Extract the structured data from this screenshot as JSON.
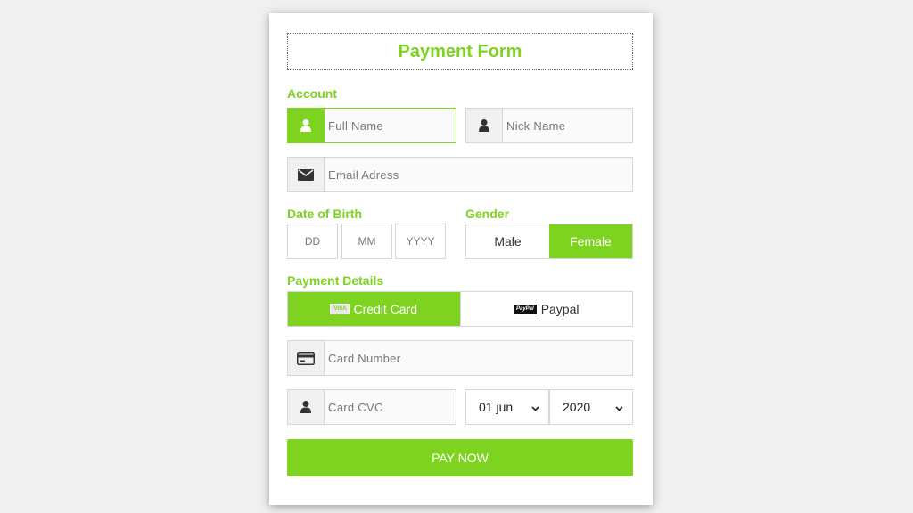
{
  "form": {
    "title": "Payment Form",
    "account_label": "Account",
    "full_name_placeholder": "Full Name",
    "nick_name_placeholder": "Nick Name",
    "email_placeholder": "Email Adress",
    "dob_label": "Date of Birth",
    "dob_day": "DD",
    "dob_month": "MM",
    "dob_year": "YYYY",
    "gender_label": "Gender",
    "gender_male": "Male",
    "gender_female": "Female",
    "gender_selected": "Female",
    "payment_label": "Payment Details",
    "method_credit": "Credit Card",
    "method_paypal": "Paypal",
    "method_selected": "Credit Card",
    "visa_badge": "VISA",
    "paypal_badge": "PayPal",
    "card_number_placeholder": "Card Number",
    "card_cvc_placeholder": "Card CVC",
    "expiry_month": "01 jun",
    "expiry_year": "2020",
    "pay_button": "PAY NOW"
  },
  "colors": {
    "accent": "#7ed321",
    "background": "#f0f0f0",
    "card": "#ffffff"
  },
  "icons": [
    "user-icon",
    "envelope-icon",
    "credit-card-icon",
    "chevron-down-icon"
  ]
}
